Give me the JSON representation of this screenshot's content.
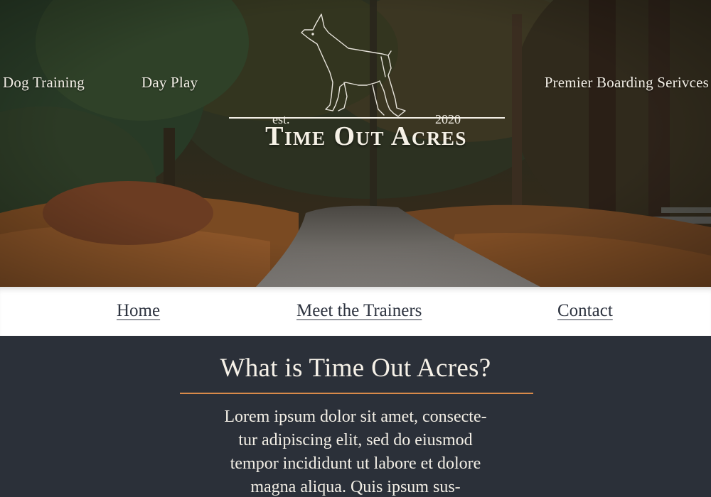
{
  "hero": {
    "links": [
      "Dog Training",
      "Day Play",
      "Premier Boarding Serivces"
    ],
    "logo": {
      "est": "est.",
      "year": "2020",
      "name": "Time Out Acres",
      "icon": "doberman-outline-icon"
    }
  },
  "nav": {
    "items": [
      "Home",
      "Meet the Trainers",
      "Contact"
    ]
  },
  "main": {
    "title": "What is Time Out Acres?",
    "body": "Lorem ipsum dolor sit amet, consecte-\ntur adipiscing elit, sed do eiusmod\ntempor incididunt ut labore et dolore\nmagna aliqua. Quis ipsum sus-"
  },
  "colors": {
    "content_background": "#2b3039",
    "accent_rule": "#d98a4a",
    "nav_background": "#ffffff",
    "nav_text": "#2e3440"
  }
}
